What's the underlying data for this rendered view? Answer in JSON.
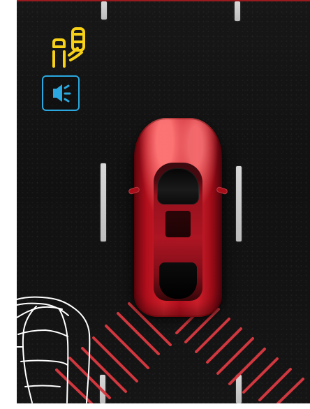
{
  "scene": {
    "alert_active": true,
    "sound_alert_active": true,
    "vehicle_color": "#c51a25",
    "warning_zone_color": "#d5383f",
    "approaching_vehicle_outline_color": "#ffffff"
  },
  "icons": {
    "blind_spot_icon": "blind-spot-monitoring-icon",
    "speaker_icon": "speaker-icon",
    "speaker_icon_color": "#2aa8df",
    "warning_icon_color": "#f7d117"
  }
}
